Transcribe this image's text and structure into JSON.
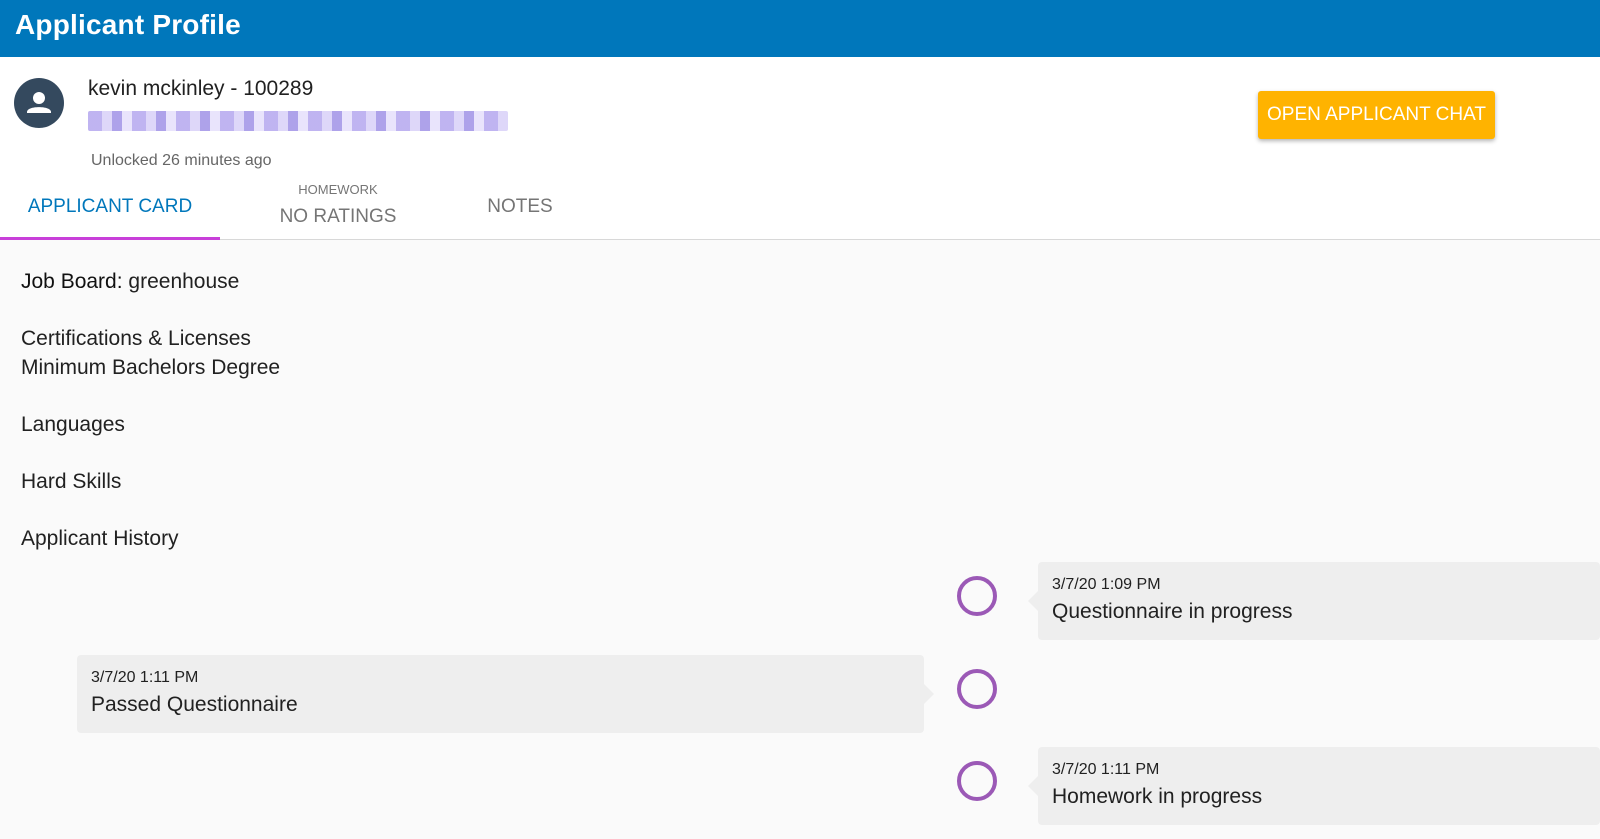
{
  "header": {
    "title": "Applicant Profile"
  },
  "applicant": {
    "name_line": "kevin mckinley - 100289",
    "unlocked_status": "Unlocked 26 minutes ago",
    "chat_button_label": "OPEN APPLICANT CHAT"
  },
  "tabs": {
    "card_label": "APPLICANT CARD",
    "homework_sublabel": "HOMEWORK",
    "homework_label": "NO RATINGS",
    "notes_label": "NOTES"
  },
  "card": {
    "job_board_label": "Job Board:",
    "job_board_value": "greenhouse",
    "certs_label": "Certifications & Licenses",
    "certs_value": "Minimum Bachelors Degree",
    "languages_label": "Languages",
    "hard_skills_label": "Hard Skills",
    "history_label": "Applicant History"
  },
  "history": [
    {
      "timestamp": "3/7/20 1:09 PM",
      "event": "Questionnaire in progress",
      "side": "right"
    },
    {
      "timestamp": "3/7/20 1:11 PM",
      "event": "Passed Questionnaire",
      "side": "left"
    },
    {
      "timestamp": "3/7/20 1:11 PM",
      "event": "Homework in progress",
      "side": "right"
    }
  ],
  "colors": {
    "topbar": "#0077bb",
    "chat_button": "#ffb300",
    "active_tab_text": "#0077bb",
    "active_tab_indicator": "#c83fd9",
    "timeline_dot": "#9b59b6",
    "avatar": "#34495e"
  },
  "icons": {
    "avatar": "person-icon",
    "email": "redacted-text"
  }
}
